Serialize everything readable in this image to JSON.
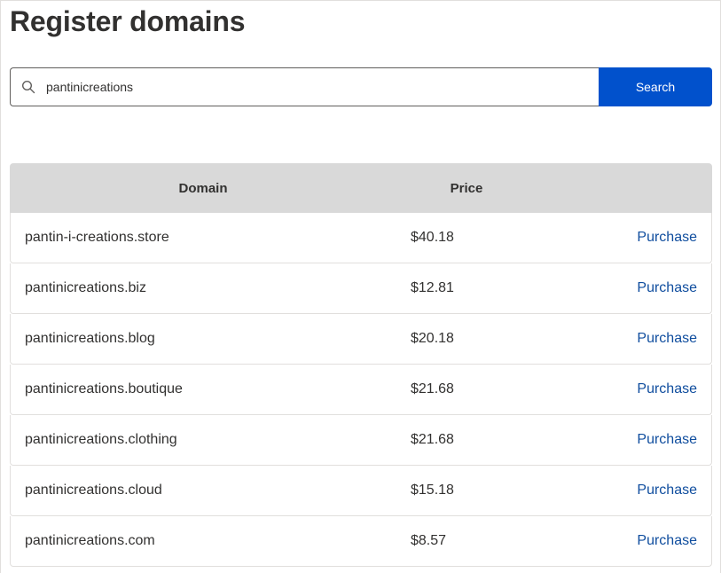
{
  "page": {
    "title": "Register domains"
  },
  "search": {
    "value": "pantinicreations",
    "placeholder": "",
    "button_label": "Search"
  },
  "table": {
    "headers": {
      "domain": "Domain",
      "price": "Price"
    },
    "rows": [
      {
        "domain": "pantin-i-creations.store",
        "price": "$40.18",
        "action": "Purchase"
      },
      {
        "domain": "pantinicreations.biz",
        "price": "$12.81",
        "action": "Purchase"
      },
      {
        "domain": "pantinicreations.blog",
        "price": "$20.18",
        "action": "Purchase"
      },
      {
        "domain": "pantinicreations.boutique",
        "price": "$21.68",
        "action": "Purchase"
      },
      {
        "domain": "pantinicreations.clothing",
        "price": "$21.68",
        "action": "Purchase"
      },
      {
        "domain": "pantinicreations.cloud",
        "price": "$15.18",
        "action": "Purchase"
      },
      {
        "domain": "pantinicreations.com",
        "price": "$8.57",
        "action": "Purchase"
      }
    ]
  },
  "colors": {
    "accent": "#0151cc",
    "link": "#0f4d9e",
    "header_bg": "#d9d9d9"
  }
}
